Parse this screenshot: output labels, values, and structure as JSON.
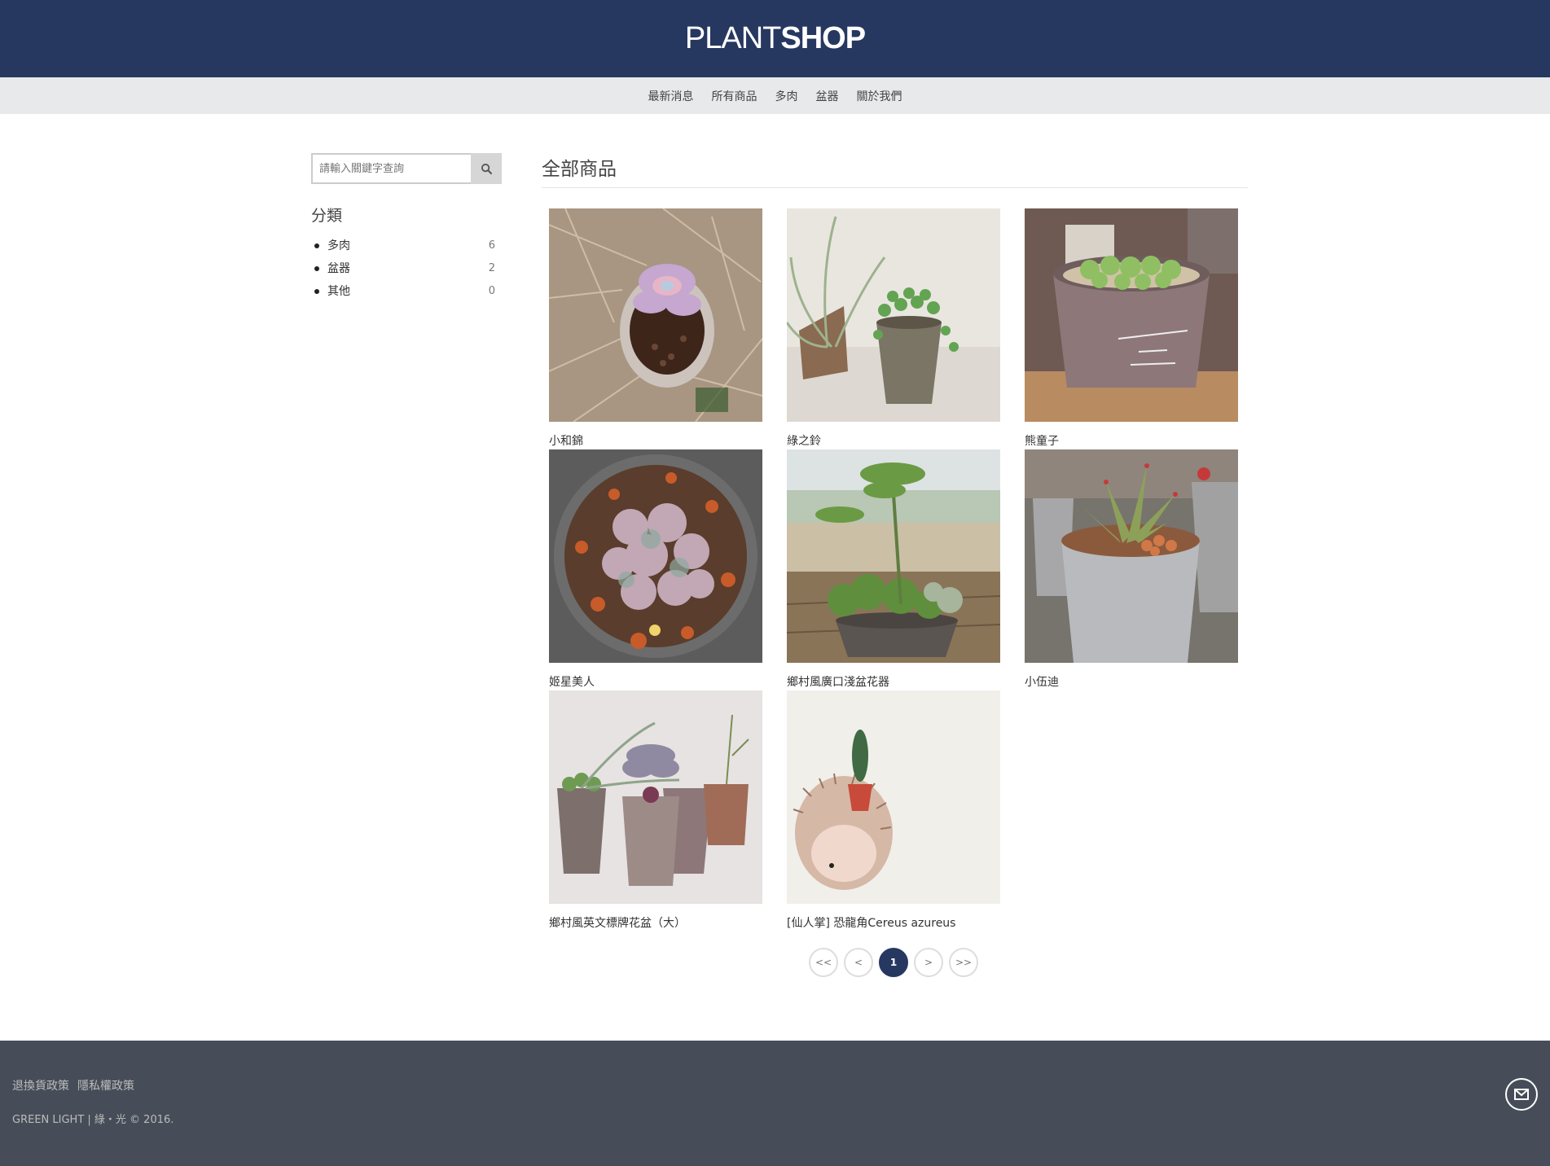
{
  "header": {
    "logo_light": "PLANT",
    "logo_bold": "SHOP"
  },
  "nav": [
    "最新消息",
    "所有商品",
    "多肉",
    "盆器",
    "關於我們"
  ],
  "sidebar": {
    "search_placeholder": "請輸入關鍵字查詢",
    "category_title": "分類",
    "categories": [
      {
        "label": "多肉",
        "count": "6"
      },
      {
        "label": "盆器",
        "count": "2"
      },
      {
        "label": "其他",
        "count": "0"
      }
    ]
  },
  "main": {
    "title": "全部商品",
    "products": [
      {
        "name": "小和錦"
      },
      {
        "name": "綠之鈴"
      },
      {
        "name": "熊童子"
      },
      {
        "name": "姬星美人"
      },
      {
        "name": "鄉村風廣口淺盆花器"
      },
      {
        "name": "小伍迪"
      },
      {
        "name": "鄉村風英文標牌花盆（大）"
      },
      {
        "name": "[仙人掌] 恐龍角Cereus azureus"
      }
    ]
  },
  "pagination": [
    "<<",
    "<",
    "1",
    ">",
    ">>"
  ],
  "footer": {
    "links": [
      "退換貨政策",
      "隱私權政策"
    ],
    "copyright": "GREEN LIGHT | 綠・光 © 2016."
  },
  "icons": {
    "search": "search-icon",
    "mail": "mail-icon"
  },
  "colors": {
    "brand": "#263860",
    "footer": "#474d58"
  }
}
